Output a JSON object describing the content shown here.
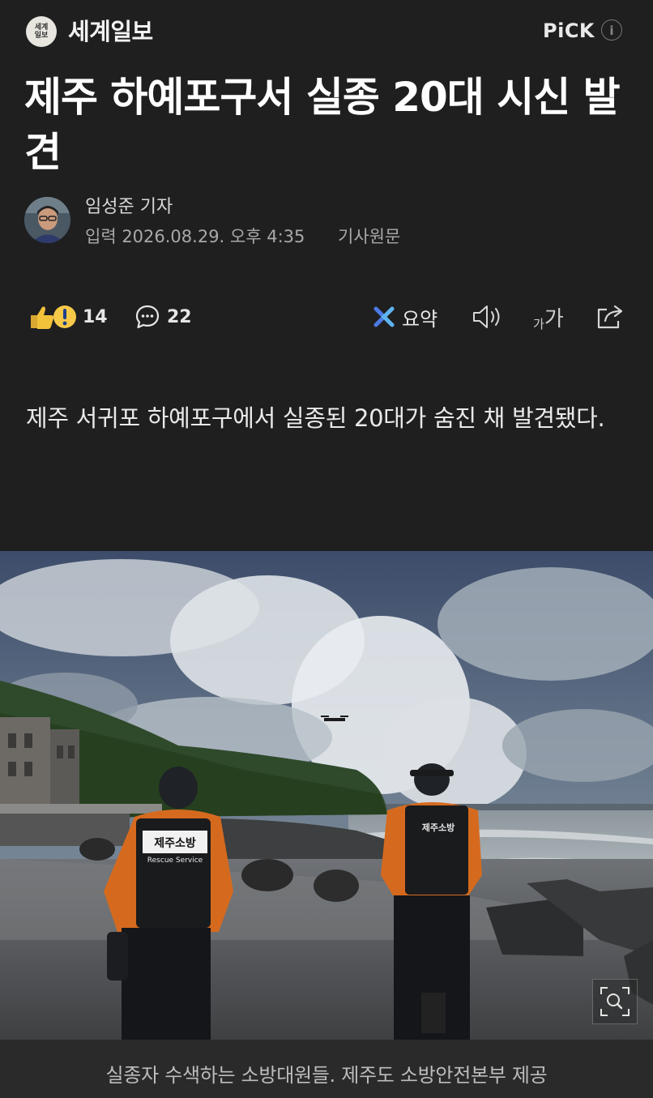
{
  "header": {
    "logo_text_top": "세계",
    "logo_text_bottom": "일보",
    "press_name": "세계일보",
    "pick_label": "PiCK",
    "info_icon": "info-icon"
  },
  "article": {
    "title": "제주 하예포구서 실종 20대 시신 발견",
    "reporter": "임성준 기자",
    "published": "입력 2026.08.29. 오후 4:35",
    "original_link": "기사원문",
    "lead": "제주 서귀포 하예포구에서 실종된 20대가 숨진 채 발견됐다."
  },
  "toolbar": {
    "reactions_count": "14",
    "comments_count": "22",
    "summary_label": "요약",
    "font_small": "가",
    "font_big": "가",
    "icons": [
      "reaction-icon",
      "comment-icon",
      "summary-icon",
      "speaker-icon",
      "font-size-icon",
      "share-icon"
    ]
  },
  "photo": {
    "vest_text_1": "제주소방",
    "vest_text_2": "Rescue Service",
    "vest_text_3": "제주소방",
    "caption": "실종자 수색하는 소방대원들. 제주도 소방안전본부 제공"
  },
  "colors": {
    "background": "#1f1f20",
    "text_primary": "#ffffff",
    "text_secondary": "#a9a9a9",
    "caption_bar": "#2a2a2b"
  }
}
